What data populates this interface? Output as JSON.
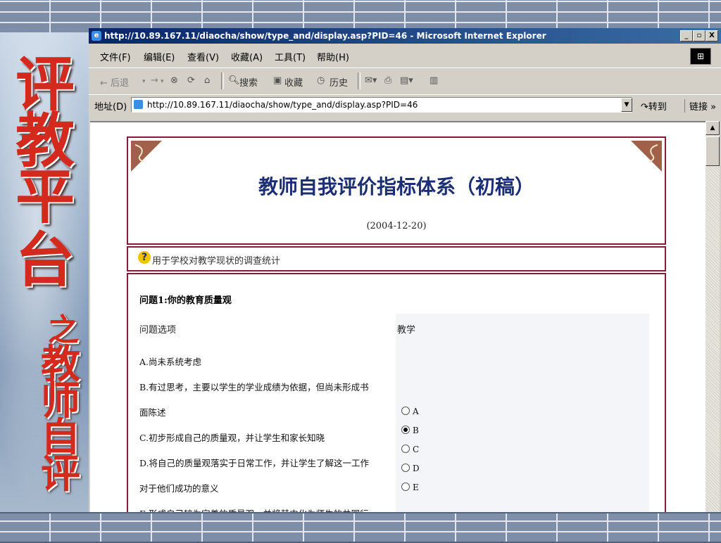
{
  "slide": {
    "big_chars": [
      "评",
      "教",
      "平",
      "台"
    ],
    "sub_chars": [
      "之",
      "教",
      "师",
      "自",
      "评"
    ],
    "accent_color": "#d42a1e"
  },
  "window": {
    "title": "http://10.89.167.11/diaocha/show/type_and/display.asp?PID=46 - Microsoft Internet Explorer",
    "title_icon": "ie-page-icon",
    "controls": [
      "_",
      "▫",
      "X"
    ]
  },
  "menu": [
    "文件(F)",
    "编辑(E)",
    "查看(V)",
    "收藏(A)",
    "工具(T)",
    "帮助(H)"
  ],
  "toolbar": {
    "back": "← 后退",
    "forward": "→",
    "search": "搜索",
    "favorites": "收藏",
    "history": "历史"
  },
  "address": {
    "label": "地址(D)",
    "url": "http://10.89.167.11/diaocha/show/type_and/display.asp?PID=46",
    "go": "转到",
    "links": "链接 »"
  },
  "survey": {
    "title": "教师自我评价指标体系（初稿）",
    "date": "(2004-12-20)",
    "purpose": "用于学校对教学现状的调查统计",
    "question": "问题1:你的教育质量观",
    "option_header": "问题选项",
    "subject_header": "教学",
    "options": [
      "A.尚未系统考虑",
      "B.有过思考，主要以学生的学业成绩为依据，但尚未形成书",
      "面陈述",
      "C.初步形成自己的质量观，并让学生和家长知晓",
      "D.将自己的质量观落实于日常工作，并让学生了解这一工作",
      "对于他们成功的意义",
      "E.形成自己较为完善的质量观，并将其内化为师生的共同行"
    ],
    "choices": [
      "A",
      "B",
      "C",
      "D",
      "E"
    ],
    "selected": "B"
  }
}
